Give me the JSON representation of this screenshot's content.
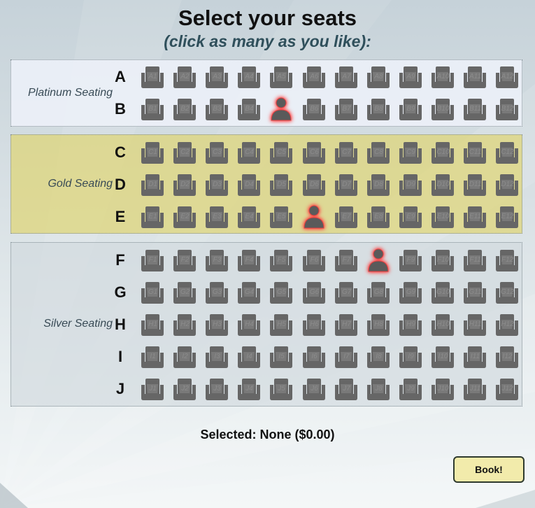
{
  "header": {
    "title": "Select your seats",
    "subtitle": "(click as many as you like):"
  },
  "sections": [
    {
      "name": "platinum",
      "label": "Platinum Seating",
      "rows": [
        "A",
        "B"
      ]
    },
    {
      "name": "gold",
      "label": "Gold Seating",
      "rows": [
        "C",
        "D",
        "E"
      ]
    },
    {
      "name": "silver",
      "label": "Silver Seating",
      "rows": [
        "F",
        "G",
        "H",
        "I",
        "J"
      ]
    }
  ],
  "seats_per_row": 12,
  "taken_seats": [
    "B5",
    "E6",
    "F8"
  ],
  "summary": {
    "text": "Selected: None ($0.00)"
  },
  "actions": {
    "book_label": "Book!"
  },
  "colors": {
    "seat_fill": "#666666",
    "seat_number_text": "#8c8c8c",
    "taken_seat_fill": "#5a5a5a",
    "taken_seat_glow": "#ff3232",
    "platinum_bg": "#ecf0f7",
    "gold_bg": "#ded46e",
    "silver_bg": "#d1d9dd",
    "book_button_bg": "#f2ebab"
  },
  "icons": {
    "available_seat": "chair-icon",
    "taken_seat": "person-icon"
  }
}
